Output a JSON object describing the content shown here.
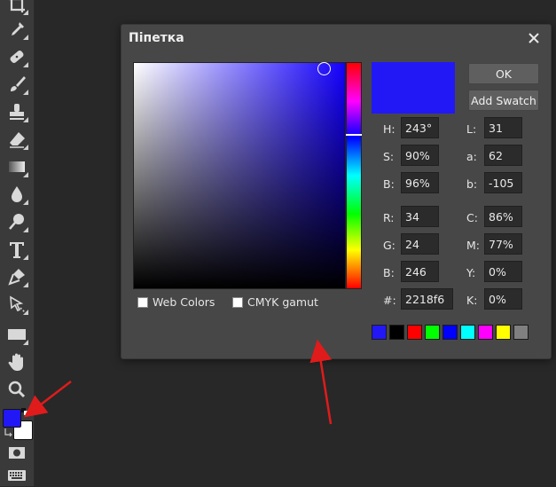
{
  "dialog": {
    "title": "Піпетка",
    "ok_label": "OK",
    "add_swatch_label": "Add Swatch",
    "web_colors_label": "Web Colors",
    "cmyk_gamut_label": "CMYK gamut"
  },
  "fields": {
    "h": {
      "label": "H:",
      "value": "243°"
    },
    "s": {
      "label": "S:",
      "value": "90%"
    },
    "bv": {
      "label": "B:",
      "value": "96%"
    },
    "r": {
      "label": "R:",
      "value": "34"
    },
    "g": {
      "label": "G:",
      "value": "24"
    },
    "b": {
      "label": "B:",
      "value": "246"
    },
    "hex": {
      "label": "#:",
      "value": "2218f6"
    },
    "l": {
      "label": "L:",
      "value": "31"
    },
    "a": {
      "label": "a:",
      "value": "62"
    },
    "lb": {
      "label": "b:",
      "value": "-105"
    },
    "c": {
      "label": "C:",
      "value": "86%"
    },
    "m": {
      "label": "M:",
      "value": "77%"
    },
    "y": {
      "label": "Y:",
      "value": "0%"
    },
    "k": {
      "label": "K:",
      "value": "0%"
    }
  },
  "colors": {
    "current": "#2218f6",
    "foreground": "#2218f6",
    "background": "#ffffff",
    "annotation_arrow": "#e01b1b"
  },
  "swatches": [
    "#2218f6",
    "#000000",
    "#ff0000",
    "#00ff00",
    "#0000ff",
    "#00ffff",
    "#ff00ff",
    "#ffff00",
    "#808080"
  ],
  "toolbar": {
    "tools": [
      "crop-icon",
      "eyedropper-icon",
      "healing-brush-icon",
      "brush-icon",
      "stamp-icon",
      "eraser-icon",
      "gradient-icon",
      "blur-drop-icon",
      "sponge-icon",
      "text-icon",
      "pen-icon",
      "path-select-icon",
      "rectangle-icon",
      "hand-icon",
      "zoom-icon"
    ]
  }
}
